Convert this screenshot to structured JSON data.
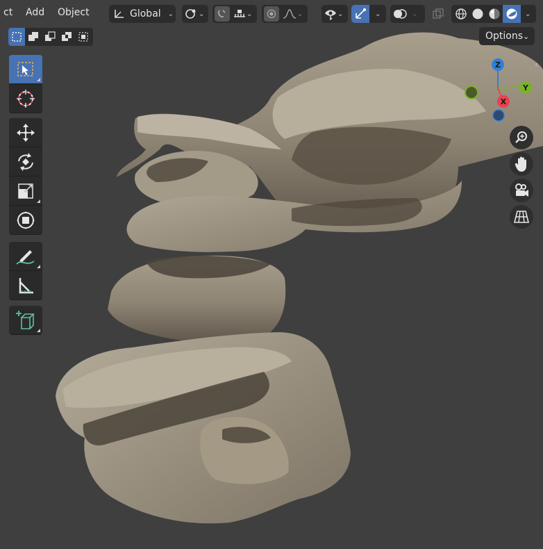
{
  "menu": {
    "partial_item": "ct",
    "add": "Add",
    "object": "Object"
  },
  "header": {
    "transform_orientation": "Global",
    "options_label": "Options"
  },
  "gizmo": {
    "z": "Z",
    "y": "Y",
    "x": "X"
  },
  "colors": {
    "accent": "#4772b3",
    "panel": "#2c2c2c",
    "viewport_bg": "#3f3f3f",
    "axis_x": "#e8424f",
    "axis_y": "#7ab32a",
    "axis_z": "#2f7fd8"
  },
  "icons": {
    "select_box": "select-box-icon",
    "cursor": "cursor-icon",
    "move": "move-icon",
    "rotate": "rotate-icon",
    "scale": "scale-icon",
    "transform": "transform-icon",
    "annotate": "annotate-icon",
    "measure": "measure-icon",
    "add_cube": "add-cube-icon"
  }
}
